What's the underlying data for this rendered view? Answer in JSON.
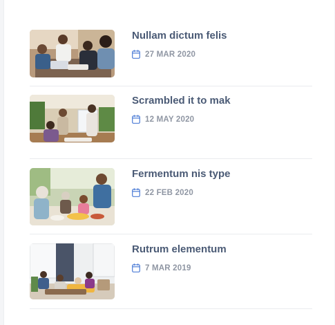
{
  "posts": [
    {
      "title": "Nullam dictum felis",
      "date": "27 MAR 2020",
      "image": "team-meeting-photo"
    },
    {
      "title": "Scrambled it to mak",
      "date": "12 MAY 2020",
      "image": "office-presentation-photo"
    },
    {
      "title": "Fermentum nis type",
      "date": "22 FEB 2020",
      "image": "family-dinner-photo"
    },
    {
      "title": "Rutrum elementum",
      "date": "7 MAR 2019",
      "image": "living-room-photo"
    }
  ],
  "icons": {
    "date": "calendar-icon"
  },
  "colors": {
    "title": "#4a5a75",
    "date": "#8f96a3",
    "icon": "#4b7bd6",
    "divider": "#e9ebee"
  }
}
